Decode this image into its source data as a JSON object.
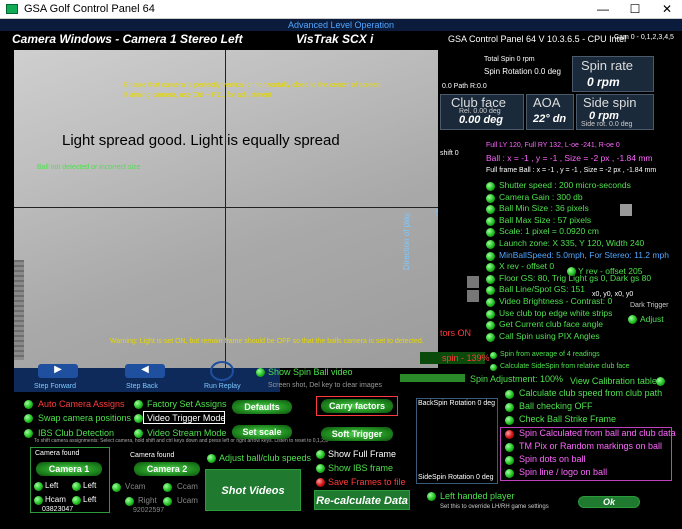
{
  "window": {
    "title": "GSA Golf Control Panel 64",
    "min": "—",
    "max": "☐",
    "close": "✕"
  },
  "subtitle": "Advanced Level Operation",
  "header": {
    "camera_windows": "Camera Windows - Camera 1 Stereo Left",
    "product": "VisTrak SCX i",
    "version": "GSA Control Panel 64 V 10.3.6.5 - CPU Intel",
    "cam_info": "Cam 0 - 0,1,2,3,4,5"
  },
  "camera_view": {
    "msg_ensure": "Ensure that camera is perfectly vertical or horizontally close to the center of screen.",
    "msg_aiming": "If aiming camera, use Ctrl + F11, for adjustment",
    "msg_light": "Light spread good. Light is equally spread",
    "msg_ball": "Ball not detected or incorrect size",
    "msg_warning": "Warning: Light is set ON, but remain frame should be OFF so that the balls camera is set to detected.",
    "direction": "Direction of play"
  },
  "nav": {
    "step_forward": "Step Forward",
    "step_back": "Step Back",
    "run_replay": "Run Replay",
    "show_spin": "Show Spin Ball video",
    "screenshot": "Screen shot, Del key to clear images"
  },
  "right_top": {
    "total_spin": "Total Spin 0 rpm",
    "spin_rotation": "Spin Rotation 0.0 deg",
    "path": "0.0 Path R:0.0",
    "shift": "shift 0",
    "errors_on": "tors ON",
    "spin_pct": "spin - 139%"
  },
  "spin_rate": {
    "label": "Spin rate",
    "value": "0 rpm"
  },
  "club_face": {
    "label": "Club face",
    "sub": "Rel. 0.00 deg",
    "value": "0.00 deg"
  },
  "aoa": {
    "label": "AOA",
    "value": "22° dn"
  },
  "side_spin": {
    "label": "Side spin",
    "value": "0 rpm",
    "sub": "Side rot. 0.0 deg"
  },
  "ball_info": {
    "full_line": "Full LY 120, Full RY 132, L-oe -241, R-oe 0",
    "ball_xy": "Ball : x = -1 , y = -1 , Size = -2 px , -1.84 mm",
    "full_frame": "Full frame Ball : x = -1 , y = -1 , Size = -2 px , -1.84 mm"
  },
  "settings": [
    "Shutter speed : 200 micro-seconds",
    "Camera Gain : 300 db",
    "Ball Min Size : 36 pixels",
    "Ball Max Size : 57 pixels",
    "Scale: 1 pixel = 0.0920 cm",
    "Launch zone: X 335, Y 120, Width 240",
    "MinBallSpeed: 5.0mph, For Stereo: 11.2 mph",
    "X rev - offset 0",
    "Floor GS: 80, Trig Light gs 0, Dark gs 80",
    "Ball Line/Spot GS: 151",
    "Video Brightness - Contrast: 0",
    "Use club top edge white strips",
    "Get Current club face angle",
    "Call Spin using PIX Angles"
  ],
  "y_rev": "Y rev - offset 205",
  "coords": "x0, y0, x0, y0",
  "dark_trigger": "Dark Trigger",
  "adjust": "Adjust",
  "spin_avg": "Spin from average of 4 readings",
  "calc_side": "Calculate SideSpin from relative club face",
  "spin_adj": "Spin Adjustment: 100%",
  "view_calib": "View Calibration table",
  "left_options": {
    "auto_cam": "Auto Camera Assigns",
    "factory": "Factory Set Assigns",
    "swap": "Swap camera positions",
    "video_trigger": "Video Trigger Mode",
    "ibs": "IBS Club Detection",
    "video_stream": "Video Stream Mode",
    "hint": "To shift camera assignments: Select camera, hold shift and ctrl keys down and press left or right arrow keys. Listen to reset to 0,1,2,3"
  },
  "buttons": {
    "defaults": "Defaults",
    "carry": "Carry factors",
    "set_scale": "Set scale",
    "soft_trigger": "Soft Trigger",
    "shot_videos": "Shot Videos",
    "recalc": "Re-calculate Data",
    "ok": "Ok"
  },
  "cam1": {
    "found": "Camera found",
    "name": "Camera 1",
    "left1": "Left",
    "left2": "Left",
    "hcam": "Hcam",
    "left3": "Left",
    "serial": "03823047"
  },
  "cam2": {
    "found": "Camera found",
    "name": "Camera 2",
    "vcam": "Vcam",
    "ccam": "Ccam",
    "right": "Right",
    "ucam": "Ucam",
    "serial": "92022597"
  },
  "adjust_speeds": "Adjust ball/club speeds",
  "show_full": "Show Full Frame",
  "show_ibs": "Show IBS frame",
  "save_frames": "Save Frames to file",
  "back_spin": "BackSpin Rotation 0 deg",
  "side_spin_rot": "SideSpin Rotation 0 deg",
  "left_handed": "Left handed player",
  "left_handed_sub": "Set this to override LH/RH game settings",
  "club_opts": [
    "Calculate club speed from club path",
    "Ball checking OFF",
    "Check Ball Strike Frame"
  ],
  "spin_opts": [
    "Spin Calculated from ball and club data",
    "TM Pix or Random markings on ball",
    "Spin dots on ball",
    "Spin line / logo on ball"
  ]
}
